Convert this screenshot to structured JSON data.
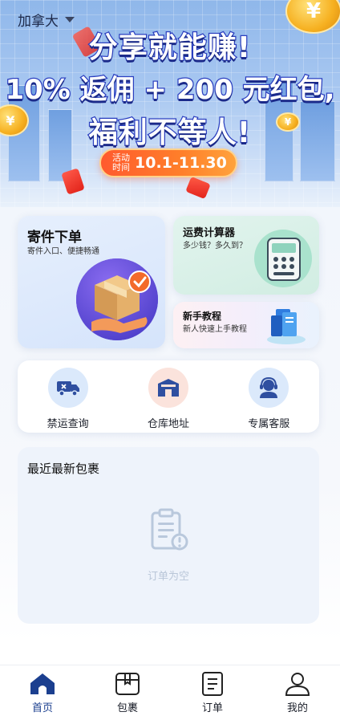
{
  "header": {
    "region_label": "加拿大"
  },
  "banner": {
    "headline_line1": "分享就能赚!",
    "headline_line2": "10% 返佣 + 200 元红包,",
    "headline_line3": "福利不等人!",
    "activity_label_1": "活动",
    "activity_label_2": "时间",
    "activity_dates": "10.1-11.30"
  },
  "cards": {
    "ship": {
      "title": "寄件下单",
      "subtitle": "寄件入口、便捷畅通"
    },
    "fee": {
      "title": "运费计算器",
      "subtitle": "多少钱？多久到？"
    },
    "guide": {
      "title": "新手教程",
      "subtitle": "新人快速上手教程"
    }
  },
  "quick_actions": [
    {
      "label": "禁运查询",
      "icon": "truck-icon"
    },
    {
      "label": "仓库地址",
      "icon": "warehouse-icon"
    },
    {
      "label": "专属客服",
      "icon": "headset-icon"
    }
  ],
  "recent": {
    "title": "最近最新包裹",
    "empty_text": "订单为空"
  },
  "tabbar": [
    {
      "label": "首页",
      "icon": "home-icon",
      "active": true
    },
    {
      "label": "包裹",
      "icon": "package-icon",
      "active": false
    },
    {
      "label": "订单",
      "icon": "order-icon",
      "active": false
    },
    {
      "label": "我的",
      "icon": "user-icon",
      "active": false
    }
  ],
  "colors": {
    "brand_blue": "#1b3f8f",
    "activity_orange": "#ff6a2e",
    "headline_stroke": "#2b3fc0"
  }
}
